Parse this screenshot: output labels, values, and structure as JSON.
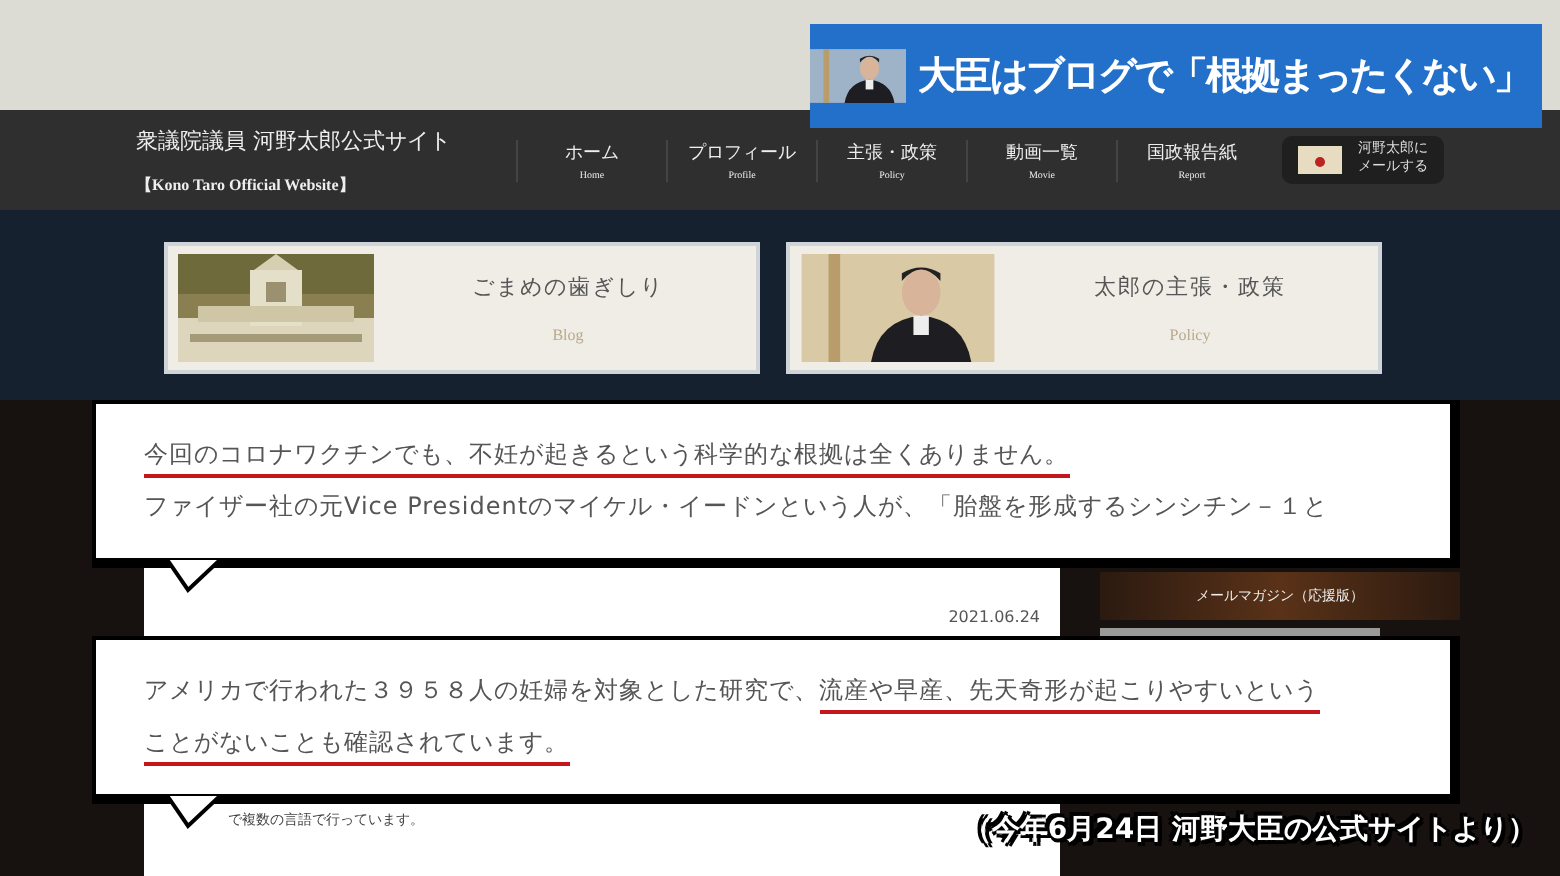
{
  "banner": {
    "headline": "大臣はブログで「根拠まったくない」"
  },
  "site": {
    "title": "衆議院議員 河野太郎公式サイト",
    "subtitle": "【Kono Taro Official Website】"
  },
  "nav": [
    {
      "label": "ホーム",
      "sub": "Home"
    },
    {
      "label": "プロフィール",
      "sub": "Profile"
    },
    {
      "label": "主張・政策",
      "sub": "Policy"
    },
    {
      "label": "動画一覧",
      "sub": "Movie"
    },
    {
      "label": "国政報告紙",
      "sub": "Report"
    }
  ],
  "mail_button": {
    "lines": [
      "河野太郎に",
      "メールする"
    ]
  },
  "cards": [
    {
      "kind": "building",
      "title": "ごまめの歯ぎしり",
      "sub": "Blog"
    },
    {
      "kind": "person",
      "title": "太郎の主張・政策",
      "sub": "Policy"
    }
  ],
  "page": {
    "date": "2021.06.24",
    "sidebar_text": "メールマガジン（応援版）",
    "body_fragment": "で複数の言語で行っています。"
  },
  "callouts": [
    {
      "lines": [
        [
          {
            "text": "今回のコロナワクチンでも、不妊が起きるという科学的な根拠は全くありません。",
            "underlined": true
          }
        ],
        [
          {
            "text": "ファイザー社の元Vice Presidentのマイケル・イードンという人が、「胎盤を形成するシンシチン－１と",
            "underlined": false
          }
        ]
      ]
    },
    {
      "lines": [
        [
          {
            "text": "アメリカで行われた３９５８人の妊婦を対象とした研究で、",
            "underlined": false
          },
          {
            "text": "流産や早産、先天奇形が起こりやすいという",
            "underlined": true
          }
        ],
        [
          {
            "text": "ことがないことも確認されています。",
            "underlined": true
          }
        ]
      ]
    }
  ],
  "caption": "（今年6月24日 河野大臣の公式サイトより）"
}
